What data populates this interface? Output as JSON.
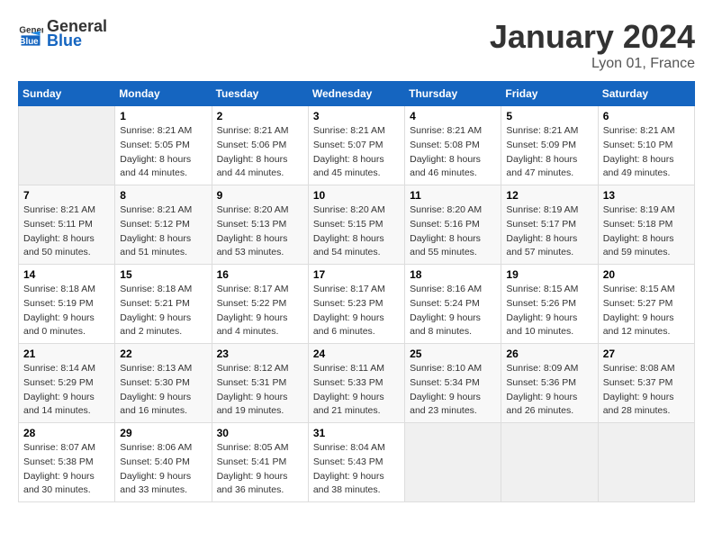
{
  "header": {
    "logo_general": "General",
    "logo_blue": "Blue",
    "month_year": "January 2024",
    "location": "Lyon 01, France"
  },
  "calendar": {
    "days_of_week": [
      "Sunday",
      "Monday",
      "Tuesday",
      "Wednesday",
      "Thursday",
      "Friday",
      "Saturday"
    ],
    "weeks": [
      [
        {
          "day": "",
          "sunrise": "",
          "sunset": "",
          "daylight": ""
        },
        {
          "day": "1",
          "sunrise": "Sunrise: 8:21 AM",
          "sunset": "Sunset: 5:05 PM",
          "daylight": "Daylight: 8 hours and 44 minutes."
        },
        {
          "day": "2",
          "sunrise": "Sunrise: 8:21 AM",
          "sunset": "Sunset: 5:06 PM",
          "daylight": "Daylight: 8 hours and 44 minutes."
        },
        {
          "day": "3",
          "sunrise": "Sunrise: 8:21 AM",
          "sunset": "Sunset: 5:07 PM",
          "daylight": "Daylight: 8 hours and 45 minutes."
        },
        {
          "day": "4",
          "sunrise": "Sunrise: 8:21 AM",
          "sunset": "Sunset: 5:08 PM",
          "daylight": "Daylight: 8 hours and 46 minutes."
        },
        {
          "day": "5",
          "sunrise": "Sunrise: 8:21 AM",
          "sunset": "Sunset: 5:09 PM",
          "daylight": "Daylight: 8 hours and 47 minutes."
        },
        {
          "day": "6",
          "sunrise": "Sunrise: 8:21 AM",
          "sunset": "Sunset: 5:10 PM",
          "daylight": "Daylight: 8 hours and 49 minutes."
        }
      ],
      [
        {
          "day": "7",
          "sunrise": "Sunrise: 8:21 AM",
          "sunset": "Sunset: 5:11 PM",
          "daylight": "Daylight: 8 hours and 50 minutes."
        },
        {
          "day": "8",
          "sunrise": "Sunrise: 8:21 AM",
          "sunset": "Sunset: 5:12 PM",
          "daylight": "Daylight: 8 hours and 51 minutes."
        },
        {
          "day": "9",
          "sunrise": "Sunrise: 8:20 AM",
          "sunset": "Sunset: 5:13 PM",
          "daylight": "Daylight: 8 hours and 53 minutes."
        },
        {
          "day": "10",
          "sunrise": "Sunrise: 8:20 AM",
          "sunset": "Sunset: 5:15 PM",
          "daylight": "Daylight: 8 hours and 54 minutes."
        },
        {
          "day": "11",
          "sunrise": "Sunrise: 8:20 AM",
          "sunset": "Sunset: 5:16 PM",
          "daylight": "Daylight: 8 hours and 55 minutes."
        },
        {
          "day": "12",
          "sunrise": "Sunrise: 8:19 AM",
          "sunset": "Sunset: 5:17 PM",
          "daylight": "Daylight: 8 hours and 57 minutes."
        },
        {
          "day": "13",
          "sunrise": "Sunrise: 8:19 AM",
          "sunset": "Sunset: 5:18 PM",
          "daylight": "Daylight: 8 hours and 59 minutes."
        }
      ],
      [
        {
          "day": "14",
          "sunrise": "Sunrise: 8:18 AM",
          "sunset": "Sunset: 5:19 PM",
          "daylight": "Daylight: 9 hours and 0 minutes."
        },
        {
          "day": "15",
          "sunrise": "Sunrise: 8:18 AM",
          "sunset": "Sunset: 5:21 PM",
          "daylight": "Daylight: 9 hours and 2 minutes."
        },
        {
          "day": "16",
          "sunrise": "Sunrise: 8:17 AM",
          "sunset": "Sunset: 5:22 PM",
          "daylight": "Daylight: 9 hours and 4 minutes."
        },
        {
          "day": "17",
          "sunrise": "Sunrise: 8:17 AM",
          "sunset": "Sunset: 5:23 PM",
          "daylight": "Daylight: 9 hours and 6 minutes."
        },
        {
          "day": "18",
          "sunrise": "Sunrise: 8:16 AM",
          "sunset": "Sunset: 5:24 PM",
          "daylight": "Daylight: 9 hours and 8 minutes."
        },
        {
          "day": "19",
          "sunrise": "Sunrise: 8:15 AM",
          "sunset": "Sunset: 5:26 PM",
          "daylight": "Daylight: 9 hours and 10 minutes."
        },
        {
          "day": "20",
          "sunrise": "Sunrise: 8:15 AM",
          "sunset": "Sunset: 5:27 PM",
          "daylight": "Daylight: 9 hours and 12 minutes."
        }
      ],
      [
        {
          "day": "21",
          "sunrise": "Sunrise: 8:14 AM",
          "sunset": "Sunset: 5:29 PM",
          "daylight": "Daylight: 9 hours and 14 minutes."
        },
        {
          "day": "22",
          "sunrise": "Sunrise: 8:13 AM",
          "sunset": "Sunset: 5:30 PM",
          "daylight": "Daylight: 9 hours and 16 minutes."
        },
        {
          "day": "23",
          "sunrise": "Sunrise: 8:12 AM",
          "sunset": "Sunset: 5:31 PM",
          "daylight": "Daylight: 9 hours and 19 minutes."
        },
        {
          "day": "24",
          "sunrise": "Sunrise: 8:11 AM",
          "sunset": "Sunset: 5:33 PM",
          "daylight": "Daylight: 9 hours and 21 minutes."
        },
        {
          "day": "25",
          "sunrise": "Sunrise: 8:10 AM",
          "sunset": "Sunset: 5:34 PM",
          "daylight": "Daylight: 9 hours and 23 minutes."
        },
        {
          "day": "26",
          "sunrise": "Sunrise: 8:09 AM",
          "sunset": "Sunset: 5:36 PM",
          "daylight": "Daylight: 9 hours and 26 minutes."
        },
        {
          "day": "27",
          "sunrise": "Sunrise: 8:08 AM",
          "sunset": "Sunset: 5:37 PM",
          "daylight": "Daylight: 9 hours and 28 minutes."
        }
      ],
      [
        {
          "day": "28",
          "sunrise": "Sunrise: 8:07 AM",
          "sunset": "Sunset: 5:38 PM",
          "daylight": "Daylight: 9 hours and 30 minutes."
        },
        {
          "day": "29",
          "sunrise": "Sunrise: 8:06 AM",
          "sunset": "Sunset: 5:40 PM",
          "daylight": "Daylight: 9 hours and 33 minutes."
        },
        {
          "day": "30",
          "sunrise": "Sunrise: 8:05 AM",
          "sunset": "Sunset: 5:41 PM",
          "daylight": "Daylight: 9 hours and 36 minutes."
        },
        {
          "day": "31",
          "sunrise": "Sunrise: 8:04 AM",
          "sunset": "Sunset: 5:43 PM",
          "daylight": "Daylight: 9 hours and 38 minutes."
        },
        {
          "day": "",
          "sunrise": "",
          "sunset": "",
          "daylight": ""
        },
        {
          "day": "",
          "sunrise": "",
          "sunset": "",
          "daylight": ""
        },
        {
          "day": "",
          "sunrise": "",
          "sunset": "",
          "daylight": ""
        }
      ]
    ]
  }
}
